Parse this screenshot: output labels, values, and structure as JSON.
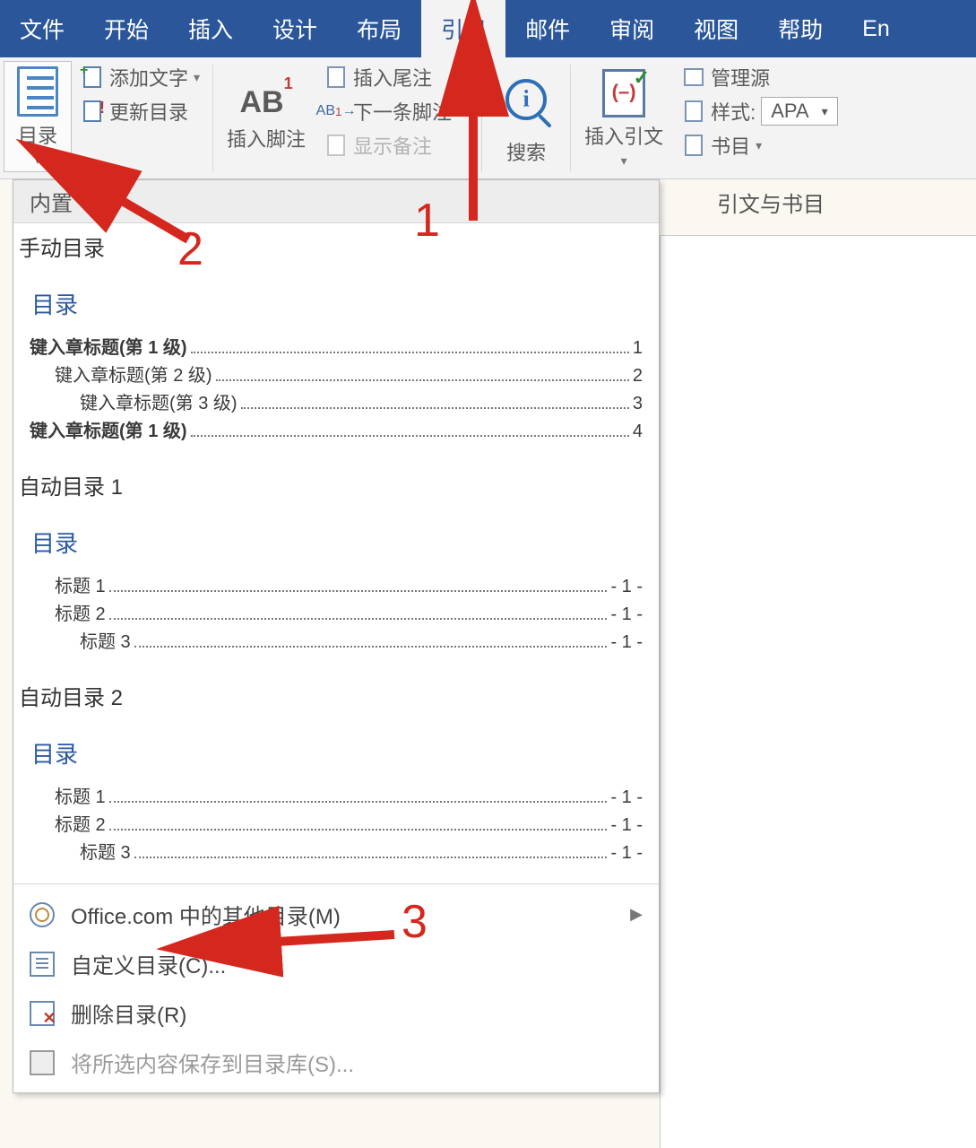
{
  "tabs": {
    "file": "文件",
    "home": "开始",
    "insert": "插入",
    "design": "设计",
    "layout": "布局",
    "references": "引用",
    "mailings": "邮件",
    "review": "审阅",
    "view": "视图",
    "help": "帮助",
    "end": "En"
  },
  "ribbon": {
    "toc_label": "目录",
    "add_text": "添加文字",
    "update_toc": "更新目录",
    "insert_footnote": "插入脚注",
    "ab1": "AB",
    "insert_endnote": "插入尾注",
    "next_footnote": "下一条脚注",
    "show_notes": "显示备注",
    "search": "搜索",
    "insert_citation": "插入引文",
    "manage_sources": "管理源",
    "style_label": "样式:",
    "style_value": "APA",
    "bibliography": "书目",
    "citations_caption": "引文与书目"
  },
  "dropdown": {
    "builtin": "内置",
    "sections": {
      "manual": "手动目录",
      "auto1": "自动目录 1",
      "auto2": "自动目录 2"
    },
    "preview_title": "目录",
    "manual_lines": [
      {
        "label": "键入章标题(第 1 级)",
        "page": "1",
        "indent": 0,
        "bold": true
      },
      {
        "label": "键入章标题(第 2 级)",
        "page": "2",
        "indent": 1,
        "bold": false
      },
      {
        "label": "键入章标题(第 3 级)",
        "page": "3",
        "indent": 2,
        "bold": false
      },
      {
        "label": "键入章标题(第 1 级)",
        "page": "4",
        "indent": 0,
        "bold": true
      }
    ],
    "auto_lines": [
      {
        "label": "标题 1",
        "page": "- 1 -",
        "indent": 1
      },
      {
        "label": "标题 2",
        "page": "- 1 -",
        "indent": 1
      },
      {
        "label": "标题 3",
        "page": "- 1 -",
        "indent": 2
      }
    ],
    "commands": {
      "more": "Office.com 中的其他目录(M)",
      "custom": "自定义目录(C)...",
      "remove": "删除目录(R)",
      "save": "将所选内容保存到目录库(S)..."
    }
  },
  "annotations": {
    "n1": "1",
    "n2": "2",
    "n3": "3"
  }
}
